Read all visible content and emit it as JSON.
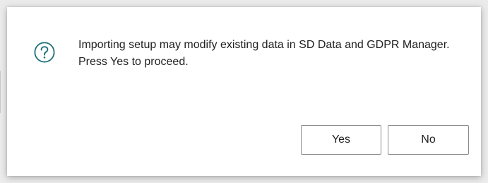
{
  "dialog": {
    "icon": "question-circle-icon",
    "message": "Importing setup may modify existing data in SD Data and GDPR Manager. Press Yes to proceed.",
    "buttons": {
      "yes_label": "Yes",
      "no_label": "No"
    }
  },
  "colors": {
    "icon": "#1f6f7a",
    "text": "#212121",
    "button_border": "#8a8a8a"
  }
}
